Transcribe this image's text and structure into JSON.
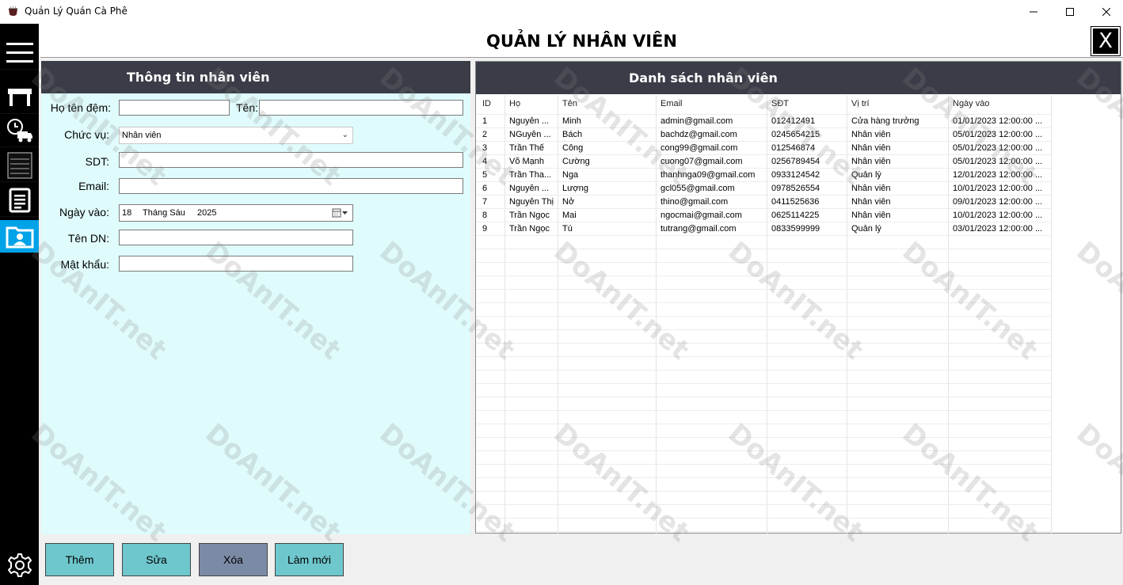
{
  "window": {
    "title": "Quản Lý Quán Cà Phê"
  },
  "header": {
    "title": "QUẢN LÝ NHÂN VIÊN",
    "close_label": "X"
  },
  "sidebar": {
    "items": [
      {
        "icon": "menu-icon"
      },
      {
        "icon": "table-icon"
      },
      {
        "icon": "delivery-truck-icon"
      },
      {
        "icon": "invoice-icon"
      },
      {
        "icon": "document-icon"
      },
      {
        "icon": "employee-folder-icon",
        "active": true
      },
      {
        "icon": "gear-icon"
      }
    ]
  },
  "form": {
    "title": "Thông tin nhân viên",
    "labels": {
      "ho_ten_dem": "Họ tên đệm:",
      "ten": "Tên:",
      "chuc_vu": "Chức vụ:",
      "sdt": "SDT:",
      "email": "Email:",
      "ngay_vao": "Ngày vào:",
      "ten_dn": "Tên DN:",
      "mat_khau": "Mật khẩu:"
    },
    "values": {
      "ho_ten_dem": "",
      "ten": "",
      "chuc_vu": "Nhân viên",
      "sdt": "",
      "email": "",
      "ngay_vao_day": "18",
      "ngay_vao_month": "Tháng Sáu",
      "ngay_vao_year": "2025",
      "ten_dn": "",
      "mat_khau": ""
    }
  },
  "list": {
    "title": "Danh sách nhân viên",
    "columns": [
      "ID",
      "Họ",
      "Tên",
      "Email",
      "SĐT",
      "Vị trí",
      "Ngày vào"
    ],
    "rows": [
      [
        "1",
        "Nguyễn ...",
        "Minh",
        "admin@gmail.com",
        "012412491",
        "Cửa hàng trưởng",
        "01/01/2023 12:00:00 ..."
      ],
      [
        "2",
        "NGuyễn ...",
        "Bách",
        "bachdz@gmail.com",
        "0245654215",
        "Nhân viên",
        "05/01/2023 12:00:00 ..."
      ],
      [
        "3",
        "Trần Thế",
        "Công",
        "cong99@gmail.com",
        "012546874",
        "Nhân viên",
        "05/01/2023 12:00:00 ..."
      ],
      [
        "4",
        "Võ Mạnh",
        "Cường",
        "cuong07@gmail.com",
        "0256789454",
        "Nhân viên",
        "05/01/2023 12:00:00 ..."
      ],
      [
        "5",
        "Trần Tha...",
        "Nga",
        "thanhnga09@gmail.com",
        "0933124542",
        "Quản lý",
        "12/01/2023 12:00:00 ..."
      ],
      [
        "6",
        "Nguyễn ...",
        "Lượng",
        "gcl055@gmail.com",
        "0978526554",
        "Nhân viên",
        "10/01/2023 12:00:00 ..."
      ],
      [
        "7",
        "Nguyễn Thị",
        "Nở",
        "thino@gmail.com",
        "0411525636",
        "Nhân viên",
        "09/01/2023 12:00:00 ..."
      ],
      [
        "8",
        "Trần Ngọc",
        "Mai",
        "ngocmai@gmail.com",
        "0625114225",
        "Nhân viên",
        "10/01/2023 12:00:00 ..."
      ],
      [
        "9",
        "Trần Ngọc",
        "Tú",
        "tutrang@gmail.com",
        "0833599999",
        "Quản lý",
        "03/01/2023 12:00:00 ..."
      ]
    ]
  },
  "buttons": {
    "them": "Thêm",
    "sua": "Sửa",
    "xoa": "Xóa",
    "lam_moi": "Làm mới"
  },
  "watermark": "DoAnIT.net"
}
